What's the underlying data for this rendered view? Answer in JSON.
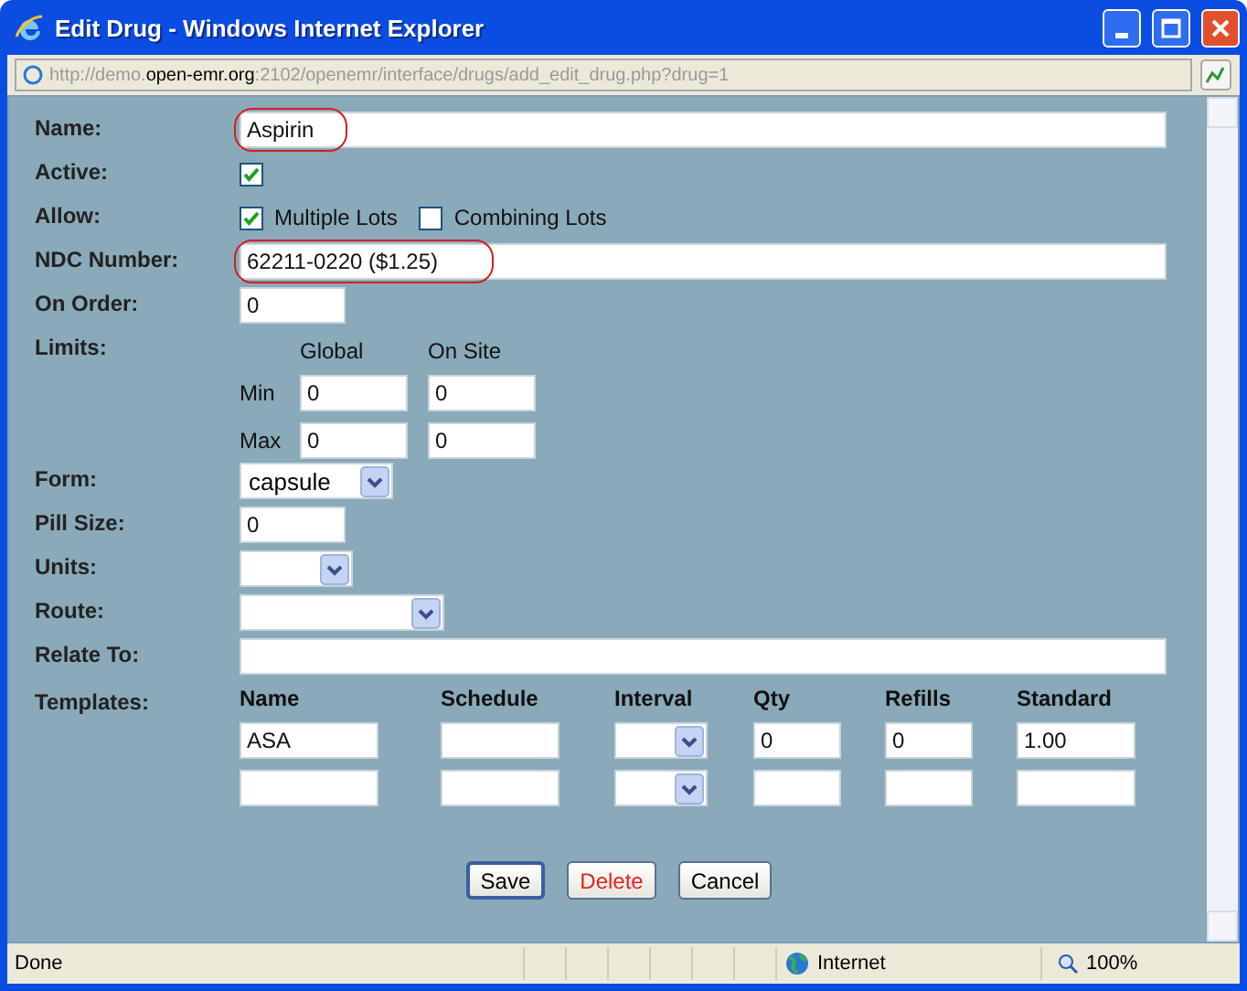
{
  "window": {
    "title": "Edit Drug - Windows Internet Explorer"
  },
  "address_bar": {
    "url_parts": [
      {
        "text": "http://demo.",
        "strong": false
      },
      {
        "text": "open-emr.org",
        "strong": true
      },
      {
        "text": ":2102/openemr/interface/drugs/add_edit_drug.php?drug=1",
        "strong": false
      }
    ]
  },
  "form": {
    "fields": [
      {
        "kind": "text",
        "label": "Name:",
        "value": "Aspirin",
        "highlighted": true,
        "wide": true
      },
      {
        "kind": "checkbox",
        "label": "Active:",
        "checked": true
      },
      {
        "kind": "checkboxes",
        "label": "Allow:",
        "options": [
          {
            "label": "Multiple Lots",
            "checked": true
          },
          {
            "label": "Combining Lots",
            "checked": false
          }
        ]
      },
      {
        "kind": "text",
        "label": "NDC Number:",
        "value": "62211-0220 ($1.25)",
        "highlighted": true,
        "wide": true
      },
      {
        "kind": "text",
        "label": "On Order:",
        "value": "0",
        "highlighted": false,
        "wide": false
      },
      {
        "kind": "limits",
        "label": "Limits:",
        "columns": [
          "Global",
          "On Site"
        ],
        "rows": [
          {
            "label": "Min",
            "values": [
              "0",
              "0"
            ]
          },
          {
            "label": "Max",
            "values": [
              "0",
              "0"
            ]
          }
        ]
      },
      {
        "kind": "select",
        "label": "Form:",
        "value": "capsule"
      },
      {
        "kind": "text",
        "label": "Pill Size:",
        "value": "0",
        "highlighted": false,
        "wide": false
      },
      {
        "kind": "select",
        "label": "Units:"
      },
      {
        "kind": "select",
        "label": "Route:"
      },
      {
        "kind": "text",
        "label": "Relate To:",
        "highlighted": false,
        "wide": true
      },
      {
        "kind": "templates",
        "label": "Templates:",
        "columns": [
          "Name",
          "Schedule",
          "Interval",
          "Qty",
          "Refills",
          "Standard"
        ],
        "rows": [
          [
            "ASA",
            "",
            "",
            "0",
            "0",
            "1.00"
          ],
          [
            "",
            "",
            "",
            "",
            "",
            ""
          ]
        ]
      }
    ]
  },
  "buttons": [
    {
      "label": "Save",
      "kind": "default"
    },
    {
      "label": "Delete",
      "kind": "danger"
    },
    {
      "label": "Cancel",
      "kind": "normal"
    }
  ],
  "status_bar": {
    "status": "Done",
    "zone": "Internet",
    "zoom": "100%"
  }
}
